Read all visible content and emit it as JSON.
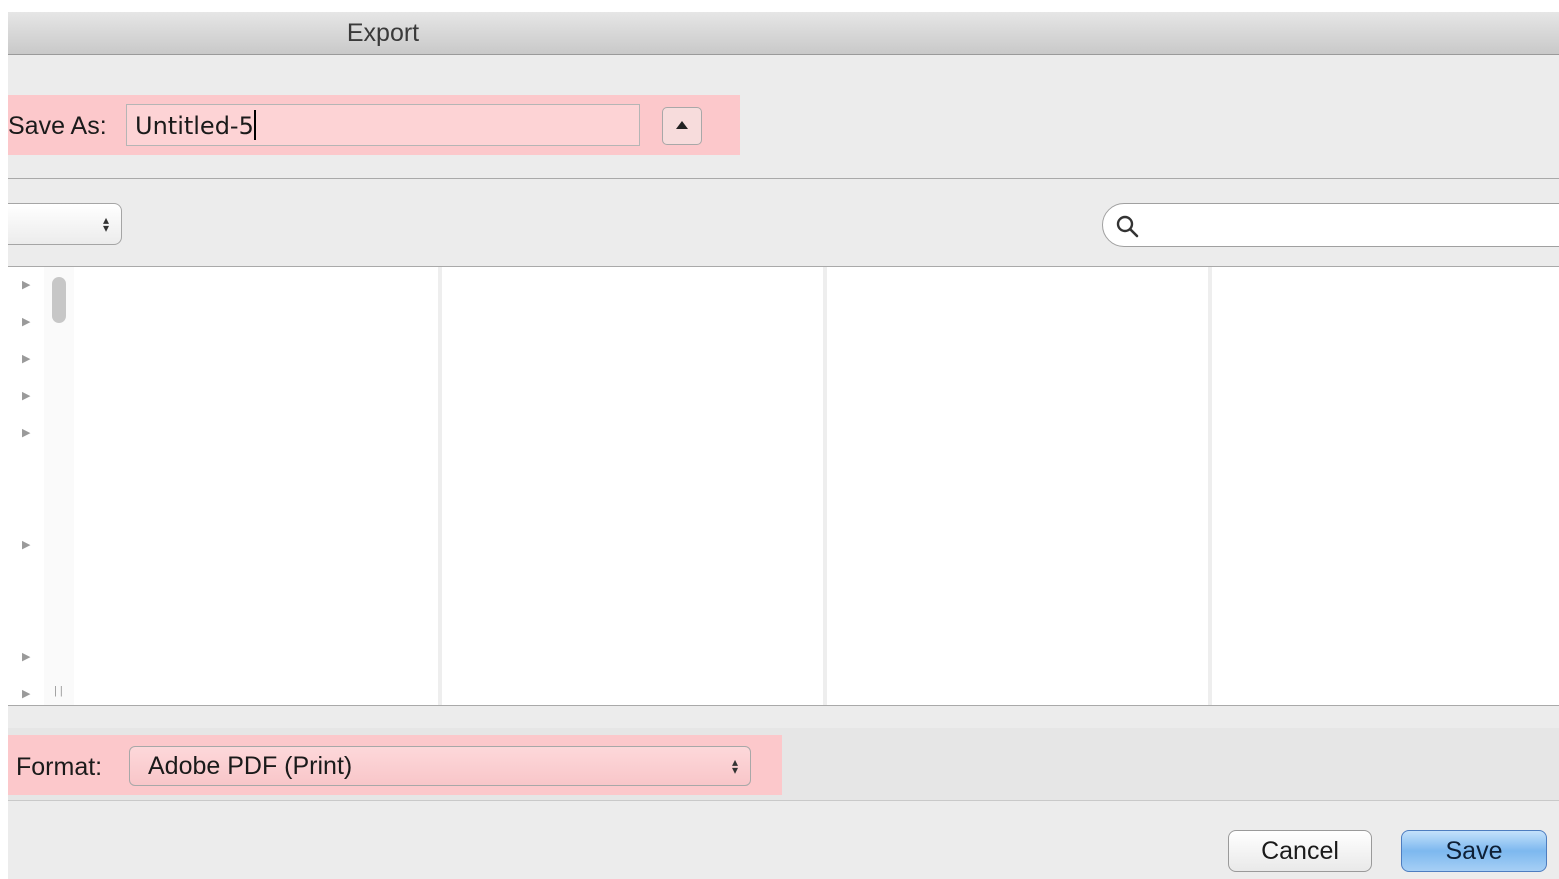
{
  "window": {
    "title": "Export"
  },
  "save_as": {
    "label": "Save As:",
    "value": "Untitled-5"
  },
  "toolbar": {
    "location": "",
    "search_placeholder": ""
  },
  "sidebar": {
    "disclosure_count": 8
  },
  "format": {
    "label": "Format:",
    "value": "Adobe PDF (Print)"
  },
  "buttons": {
    "cancel": "Cancel",
    "save": "Save"
  },
  "colors": {
    "highlight": "#fcc8cb",
    "default_button": "#7db8ef"
  },
  "icons": {
    "expand": "triangle-up-icon",
    "popup": "up-down-arrows-icon",
    "search": "magnifier-icon",
    "disclosure": "disclosure-triangle-icon"
  }
}
